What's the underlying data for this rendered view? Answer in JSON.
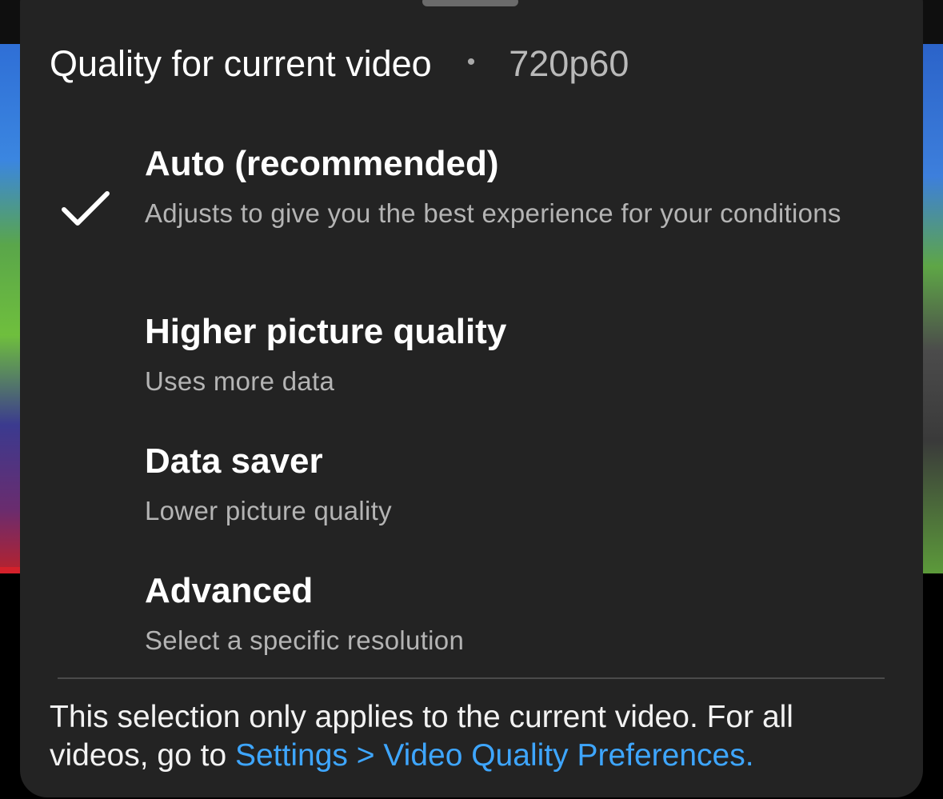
{
  "sheet": {
    "header": {
      "title": "Quality for current video",
      "separator": "•",
      "current_quality": "720p60"
    },
    "options": [
      {
        "title": "Auto (recommended)",
        "subtitle": "Adjusts to give you the best experience for your conditions",
        "selected": true
      },
      {
        "title": "Higher picture quality",
        "subtitle": "Uses more data",
        "selected": false
      },
      {
        "title": "Data saver",
        "subtitle": "Lower picture quality",
        "selected": false
      },
      {
        "title": "Advanced",
        "subtitle": "Select a specific resolution",
        "selected": false
      }
    ],
    "footer": {
      "text": "This selection only applies to the current video. For all videos, go to ",
      "link_label": "Settings > Video Quality Preferences."
    },
    "icons": {
      "selected_option": "checkmark-icon",
      "sheet_handle": "drag-handle"
    },
    "colors": {
      "sheet_background": "#232323",
      "primary_text": "#ffffff",
      "secondary_text": "#b4b4b4",
      "link": "#3ea6ff"
    }
  }
}
